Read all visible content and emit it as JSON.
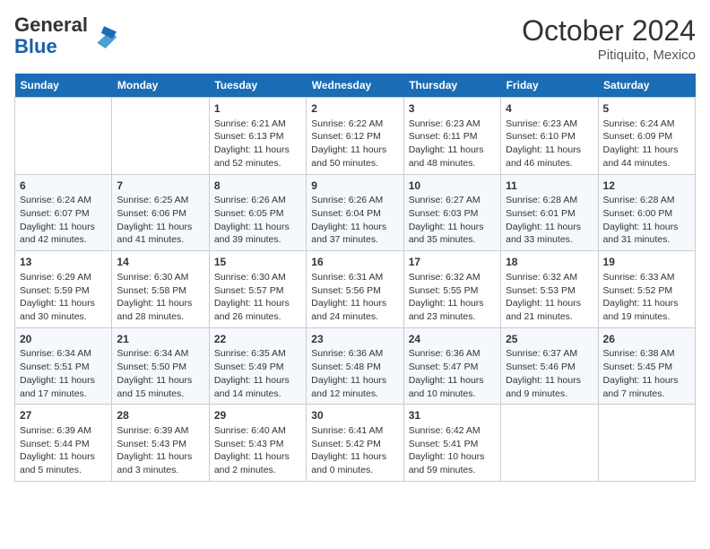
{
  "header": {
    "logo_general": "General",
    "logo_blue": "Blue",
    "month": "October 2024",
    "location": "Pitiquito, Mexico"
  },
  "days_of_week": [
    "Sunday",
    "Monday",
    "Tuesday",
    "Wednesday",
    "Thursday",
    "Friday",
    "Saturday"
  ],
  "weeks": [
    [
      {
        "day": "",
        "info": ""
      },
      {
        "day": "",
        "info": ""
      },
      {
        "day": "1",
        "sunrise": "Sunrise: 6:21 AM",
        "sunset": "Sunset: 6:13 PM",
        "daylight": "Daylight: 11 hours and 52 minutes."
      },
      {
        "day": "2",
        "sunrise": "Sunrise: 6:22 AM",
        "sunset": "Sunset: 6:12 PM",
        "daylight": "Daylight: 11 hours and 50 minutes."
      },
      {
        "day": "3",
        "sunrise": "Sunrise: 6:23 AM",
        "sunset": "Sunset: 6:11 PM",
        "daylight": "Daylight: 11 hours and 48 minutes."
      },
      {
        "day": "4",
        "sunrise": "Sunrise: 6:23 AM",
        "sunset": "Sunset: 6:10 PM",
        "daylight": "Daylight: 11 hours and 46 minutes."
      },
      {
        "day": "5",
        "sunrise": "Sunrise: 6:24 AM",
        "sunset": "Sunset: 6:09 PM",
        "daylight": "Daylight: 11 hours and 44 minutes."
      }
    ],
    [
      {
        "day": "6",
        "sunrise": "Sunrise: 6:24 AM",
        "sunset": "Sunset: 6:07 PM",
        "daylight": "Daylight: 11 hours and 42 minutes."
      },
      {
        "day": "7",
        "sunrise": "Sunrise: 6:25 AM",
        "sunset": "Sunset: 6:06 PM",
        "daylight": "Daylight: 11 hours and 41 minutes."
      },
      {
        "day": "8",
        "sunrise": "Sunrise: 6:26 AM",
        "sunset": "Sunset: 6:05 PM",
        "daylight": "Daylight: 11 hours and 39 minutes."
      },
      {
        "day": "9",
        "sunrise": "Sunrise: 6:26 AM",
        "sunset": "Sunset: 6:04 PM",
        "daylight": "Daylight: 11 hours and 37 minutes."
      },
      {
        "day": "10",
        "sunrise": "Sunrise: 6:27 AM",
        "sunset": "Sunset: 6:03 PM",
        "daylight": "Daylight: 11 hours and 35 minutes."
      },
      {
        "day": "11",
        "sunrise": "Sunrise: 6:28 AM",
        "sunset": "Sunset: 6:01 PM",
        "daylight": "Daylight: 11 hours and 33 minutes."
      },
      {
        "day": "12",
        "sunrise": "Sunrise: 6:28 AM",
        "sunset": "Sunset: 6:00 PM",
        "daylight": "Daylight: 11 hours and 31 minutes."
      }
    ],
    [
      {
        "day": "13",
        "sunrise": "Sunrise: 6:29 AM",
        "sunset": "Sunset: 5:59 PM",
        "daylight": "Daylight: 11 hours and 30 minutes."
      },
      {
        "day": "14",
        "sunrise": "Sunrise: 6:30 AM",
        "sunset": "Sunset: 5:58 PM",
        "daylight": "Daylight: 11 hours and 28 minutes."
      },
      {
        "day": "15",
        "sunrise": "Sunrise: 6:30 AM",
        "sunset": "Sunset: 5:57 PM",
        "daylight": "Daylight: 11 hours and 26 minutes."
      },
      {
        "day": "16",
        "sunrise": "Sunrise: 6:31 AM",
        "sunset": "Sunset: 5:56 PM",
        "daylight": "Daylight: 11 hours and 24 minutes."
      },
      {
        "day": "17",
        "sunrise": "Sunrise: 6:32 AM",
        "sunset": "Sunset: 5:55 PM",
        "daylight": "Daylight: 11 hours and 23 minutes."
      },
      {
        "day": "18",
        "sunrise": "Sunrise: 6:32 AM",
        "sunset": "Sunset: 5:53 PM",
        "daylight": "Daylight: 11 hours and 21 minutes."
      },
      {
        "day": "19",
        "sunrise": "Sunrise: 6:33 AM",
        "sunset": "Sunset: 5:52 PM",
        "daylight": "Daylight: 11 hours and 19 minutes."
      }
    ],
    [
      {
        "day": "20",
        "sunrise": "Sunrise: 6:34 AM",
        "sunset": "Sunset: 5:51 PM",
        "daylight": "Daylight: 11 hours and 17 minutes."
      },
      {
        "day": "21",
        "sunrise": "Sunrise: 6:34 AM",
        "sunset": "Sunset: 5:50 PM",
        "daylight": "Daylight: 11 hours and 15 minutes."
      },
      {
        "day": "22",
        "sunrise": "Sunrise: 6:35 AM",
        "sunset": "Sunset: 5:49 PM",
        "daylight": "Daylight: 11 hours and 14 minutes."
      },
      {
        "day": "23",
        "sunrise": "Sunrise: 6:36 AM",
        "sunset": "Sunset: 5:48 PM",
        "daylight": "Daylight: 11 hours and 12 minutes."
      },
      {
        "day": "24",
        "sunrise": "Sunrise: 6:36 AM",
        "sunset": "Sunset: 5:47 PM",
        "daylight": "Daylight: 11 hours and 10 minutes."
      },
      {
        "day": "25",
        "sunrise": "Sunrise: 6:37 AM",
        "sunset": "Sunset: 5:46 PM",
        "daylight": "Daylight: 11 hours and 9 minutes."
      },
      {
        "day": "26",
        "sunrise": "Sunrise: 6:38 AM",
        "sunset": "Sunset: 5:45 PM",
        "daylight": "Daylight: 11 hours and 7 minutes."
      }
    ],
    [
      {
        "day": "27",
        "sunrise": "Sunrise: 6:39 AM",
        "sunset": "Sunset: 5:44 PM",
        "daylight": "Daylight: 11 hours and 5 minutes."
      },
      {
        "day": "28",
        "sunrise": "Sunrise: 6:39 AM",
        "sunset": "Sunset: 5:43 PM",
        "daylight": "Daylight: 11 hours and 3 minutes."
      },
      {
        "day": "29",
        "sunrise": "Sunrise: 6:40 AM",
        "sunset": "Sunset: 5:43 PM",
        "daylight": "Daylight: 11 hours and 2 minutes."
      },
      {
        "day": "30",
        "sunrise": "Sunrise: 6:41 AM",
        "sunset": "Sunset: 5:42 PM",
        "daylight": "Daylight: 11 hours and 0 minutes."
      },
      {
        "day": "31",
        "sunrise": "Sunrise: 6:42 AM",
        "sunset": "Sunset: 5:41 PM",
        "daylight": "Daylight: 10 hours and 59 minutes."
      },
      {
        "day": "",
        "info": ""
      },
      {
        "day": "",
        "info": ""
      }
    ]
  ]
}
